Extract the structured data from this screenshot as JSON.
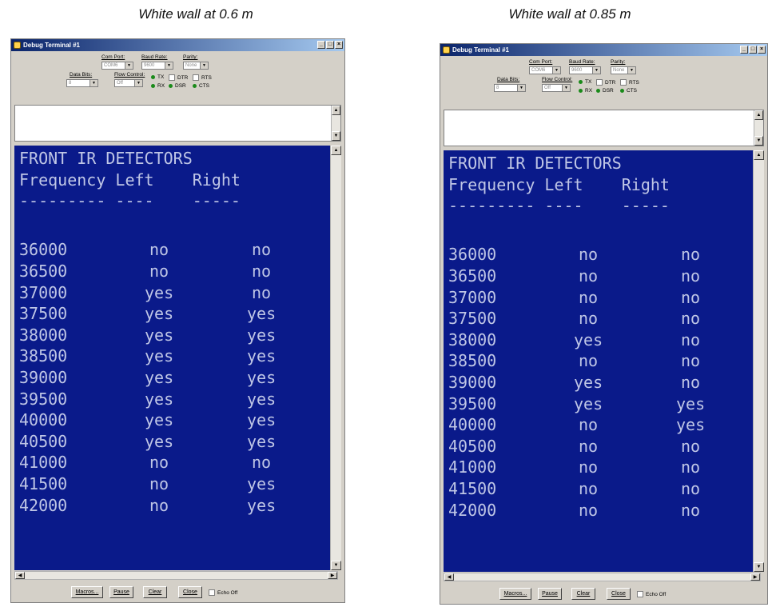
{
  "captions": [
    "White wall at 0.6 m",
    "White wall at 0.85 m"
  ],
  "window": {
    "title": "Debug Terminal #1",
    "labels": {
      "com_port": "Com Port:",
      "baud_rate": "Baud Rate:",
      "parity": "Parity:",
      "data_bits": "Data Bits:",
      "flow_control": "Flow Control:"
    },
    "values": {
      "com_port": "COM6",
      "baud_rate": "9600",
      "parity": "None",
      "data_bits": "8",
      "flow_control": "Off"
    },
    "indicators": {
      "tx": "TX",
      "rx": "RX",
      "dtr": "DTR",
      "rts": "RTS",
      "dsr": "DSR",
      "cts": "CTS"
    },
    "buttons": {
      "macros": "Macros...",
      "pause": "Pause",
      "clear": "Clear",
      "close": "Close",
      "echo": "Echo Off"
    },
    "winbtns": {
      "minimize": "_",
      "maximize": "□",
      "close": "×"
    }
  },
  "terminal": {
    "header1": "FRONT IR DETECTORS",
    "header2": "Frequency Left    Right",
    "separator": "--------- ----    -----"
  },
  "panels": [
    {
      "rows": [
        {
          "freq": "36000",
          "left": "no",
          "right": "no"
        },
        {
          "freq": "36500",
          "left": "no",
          "right": "no"
        },
        {
          "freq": "37000",
          "left": "yes",
          "right": "no"
        },
        {
          "freq": "37500",
          "left": "yes",
          "right": "yes"
        },
        {
          "freq": "38000",
          "left": "yes",
          "right": "yes"
        },
        {
          "freq": "38500",
          "left": "yes",
          "right": "yes"
        },
        {
          "freq": "39000",
          "left": "yes",
          "right": "yes"
        },
        {
          "freq": "39500",
          "left": "yes",
          "right": "yes"
        },
        {
          "freq": "40000",
          "left": "yes",
          "right": "yes"
        },
        {
          "freq": "40500",
          "left": "yes",
          "right": "yes"
        },
        {
          "freq": "41000",
          "left": "no",
          "right": "no"
        },
        {
          "freq": "41500",
          "left": "no",
          "right": "yes"
        },
        {
          "freq": "42000",
          "left": "no",
          "right": "yes"
        }
      ]
    },
    {
      "rows": [
        {
          "freq": "36000",
          "left": "no",
          "right": "no"
        },
        {
          "freq": "36500",
          "left": "no",
          "right": "no"
        },
        {
          "freq": "37000",
          "left": "no",
          "right": "no"
        },
        {
          "freq": "37500",
          "left": "no",
          "right": "no"
        },
        {
          "freq": "38000",
          "left": "yes",
          "right": "no"
        },
        {
          "freq": "38500",
          "left": "no",
          "right": "no"
        },
        {
          "freq": "39000",
          "left": "yes",
          "right": "no"
        },
        {
          "freq": "39500",
          "left": "yes",
          "right": "yes"
        },
        {
          "freq": "40000",
          "left": "no",
          "right": "yes"
        },
        {
          "freq": "40500",
          "left": "no",
          "right": "no"
        },
        {
          "freq": "41000",
          "left": "no",
          "right": "no"
        },
        {
          "freq": "41500",
          "left": "no",
          "right": "no"
        },
        {
          "freq": "42000",
          "left": "no",
          "right": "no"
        }
      ]
    }
  ],
  "colors": {
    "terminal_bg": "#0a1a8a",
    "terminal_text": "#bfc6e6",
    "led": "#1a8a1a"
  }
}
